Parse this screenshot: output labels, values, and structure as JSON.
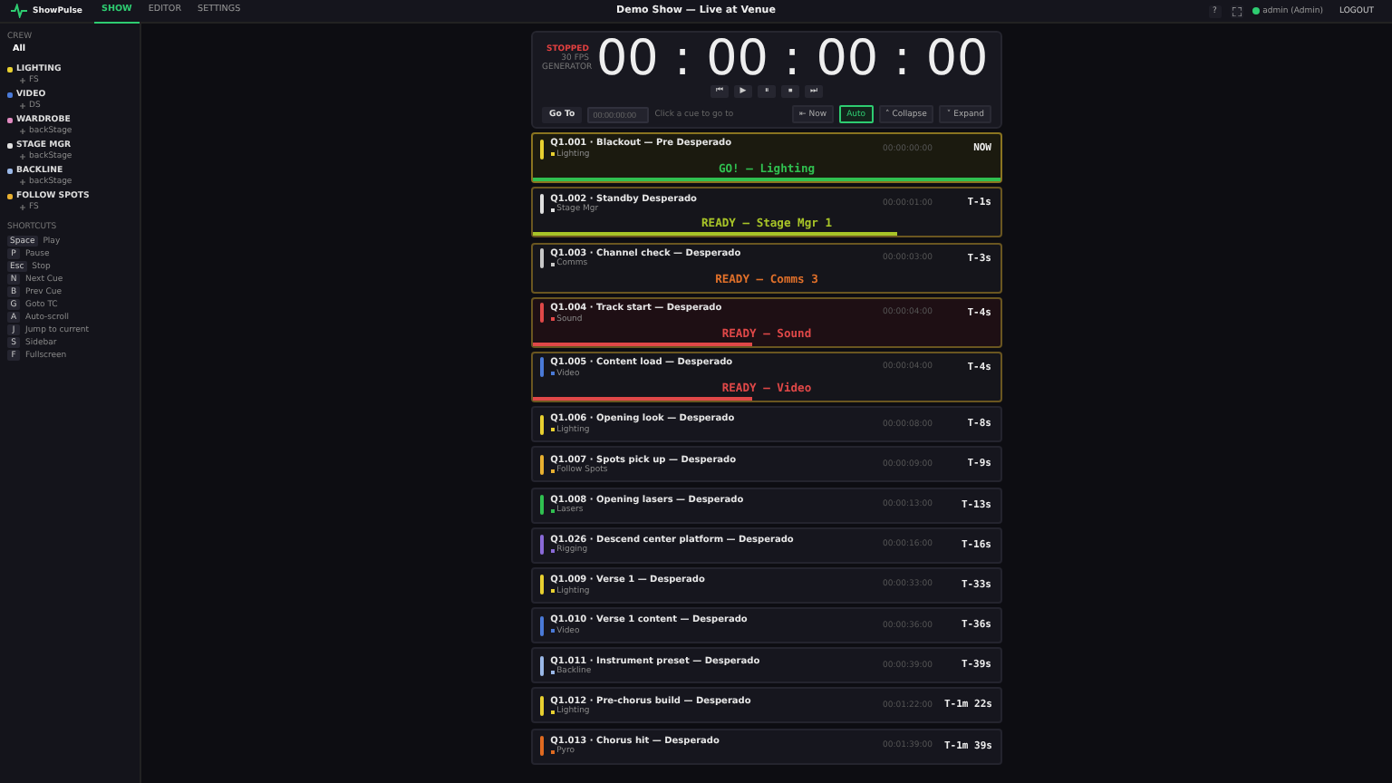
{
  "app": {
    "name": "ShowPulse"
  },
  "nav": [
    {
      "label": "SHOW",
      "selected": true
    },
    {
      "label": "EDITOR",
      "selected": false
    },
    {
      "label": "SETTINGS",
      "selected": false
    }
  ],
  "show_title": "Demo Show — Live at Venue",
  "header_right": {
    "help": "?",
    "user": "admin (Admin)",
    "online": true,
    "logout": "LOGOUT"
  },
  "sidebar": {
    "crew_label": "CREW",
    "all": "All",
    "departments": [
      {
        "name": "LIGHTING",
        "color": "#e8d030",
        "children": [
          {
            "name": "FS"
          }
        ]
      },
      {
        "name": "VIDEO",
        "color": "#4a7ad8",
        "children": [
          {
            "name": "DS"
          }
        ]
      },
      {
        "name": "WARDROBE",
        "color": "#e08ac0",
        "children": [
          {
            "name": "backStage"
          }
        ]
      },
      {
        "name": "STAGE MGR",
        "color": "#e0e0e0",
        "children": [
          {
            "name": "backStage"
          }
        ]
      },
      {
        "name": "BACKLINE",
        "color": "#9ab8e8",
        "children": [
          {
            "name": "backStage"
          }
        ]
      },
      {
        "name": "FOLLOW SPOTS",
        "color": "#e8b030",
        "children": [
          {
            "name": "FS"
          }
        ]
      }
    ],
    "shortcuts_label": "SHORTCUTS",
    "shortcuts": [
      {
        "key": "Space",
        "action": "Play"
      },
      {
        "key": "P",
        "action": "Pause"
      },
      {
        "key": "Esc",
        "action": "Stop"
      },
      {
        "key": "N",
        "action": "Next Cue"
      },
      {
        "key": "B",
        "action": "Prev Cue"
      },
      {
        "key": "G",
        "action": "Goto TC"
      },
      {
        "key": "A",
        "action": "Auto-scroll"
      },
      {
        "key": "J",
        "action": "Jump to current"
      },
      {
        "key": "S",
        "action": "Sidebar"
      },
      {
        "key": "F",
        "action": "Fullscreen"
      }
    ]
  },
  "clock": {
    "status": "STOPPED",
    "fps": "30 FPS",
    "source": "GENERATOR",
    "timecode": "00 : 00 : 00 : 00"
  },
  "transport": [
    "⏮",
    "▶",
    "⏸",
    "⏹",
    "⏭"
  ],
  "goto": {
    "label": "Go To",
    "placeholder": "00:00:00:00",
    "hint": "Click a cue to go to"
  },
  "toolbar": [
    {
      "label": "Now",
      "icon": "⇤",
      "selected": false
    },
    {
      "label": "Auto",
      "selected": true
    },
    {
      "label": "Collapse",
      "icon": "˄",
      "selected": false
    },
    {
      "label": "Expand",
      "icon": "˅",
      "selected": false
    }
  ],
  "cues": [
    {
      "kind": "go",
      "title": "Q1.001 · Blackout — Pre Desperado",
      "dept": "Lighting",
      "color": "#e8d030",
      "timecode": "00:00:00:00",
      "countdown": "NOW",
      "banner": {
        "text": "GO! — Lighting",
        "color": "#30c050"
      },
      "level": 1
    },
    {
      "kind": "ready",
      "title": "Q1.002 · Standby Desperado",
      "dept": "Stage Mgr",
      "color": "#e0e0e0",
      "timecode": "00:00:01:00",
      "countdown": "T-1s",
      "banner": {
        "text": "READY — Stage Mgr 1",
        "color": "#a8c428"
      },
      "level": 0.78
    },
    {
      "kind": "ready",
      "title": "Q1.003 · Channel check — Desperado",
      "dept": "Comms",
      "color": "#c8c8c8",
      "timecode": "00:00:03:00",
      "countdown": "T-3s",
      "banner": {
        "text": "READY — Comms 3",
        "color": "#e0702a"
      }
    },
    {
      "kind": "alert",
      "title": "Q1.004 · Track start — Desperado",
      "dept": "Sound",
      "color": "#e04848",
      "timecode": "00:00:04:00",
      "countdown": "T-4s",
      "banner": {
        "text": "READY — Sound",
        "color": "#e04848"
      },
      "level": 0.47
    },
    {
      "kind": "ready",
      "title": "Q1.005 · Content load — Desperado",
      "dept": "Video",
      "color": "#4a7ad8",
      "timecode": "00:00:04:00",
      "countdown": "T-4s",
      "banner": {
        "text": "READY — Video",
        "color": "#e04848"
      },
      "level": 0.47
    },
    {
      "kind": "plain",
      "title": "Q1.006 · Opening look — Desperado",
      "dept": "Lighting",
      "color": "#e8d030",
      "timecode": "00:00:08:00",
      "countdown": "T-8s"
    },
    {
      "kind": "plain",
      "title": "Q1.007 · Spots pick up — Desperado",
      "dept": "Follow Spots",
      "color": "#e8b030",
      "timecode": "00:00:09:00",
      "countdown": "T-9s"
    },
    {
      "kind": "plain",
      "title": "Q1.008 · Opening lasers — Desperado",
      "dept": "Lasers",
      "color": "#30c050",
      "timecode": "00:00:13:00",
      "countdown": "T-13s"
    },
    {
      "kind": "plain",
      "title": "Q1.026 · Descend center platform — Desperado",
      "dept": "Rigging",
      "color": "#8a6ad8",
      "timecode": "00:00:16:00",
      "countdown": "T-16s"
    },
    {
      "kind": "plain",
      "title": "Q1.009 · Verse 1 — Desperado",
      "dept": "Lighting",
      "color": "#e8d030",
      "timecode": "00:00:33:00",
      "countdown": "T-33s"
    },
    {
      "kind": "plain",
      "title": "Q1.010 · Verse 1 content — Desperado",
      "dept": "Video",
      "color": "#4a7ad8",
      "timecode": "00:00:36:00",
      "countdown": "T-36s"
    },
    {
      "kind": "plain",
      "title": "Q1.011 · Instrument preset — Desperado",
      "dept": "Backline",
      "color": "#9ab8e8",
      "timecode": "00:00:39:00",
      "countdown": "T-39s"
    },
    {
      "kind": "plain",
      "title": "Q1.012 · Pre-chorus build — Desperado",
      "dept": "Lighting",
      "color": "#e8d030",
      "timecode": "00:01:22:00",
      "countdown": "T-1m 22s"
    },
    {
      "kind": "plain",
      "title": "Q1.013 · Chorus hit — Desperado",
      "dept": "Pyro",
      "color": "#e06a20",
      "timecode": "00:01:39:00",
      "countdown": "T-1m 39s"
    }
  ]
}
